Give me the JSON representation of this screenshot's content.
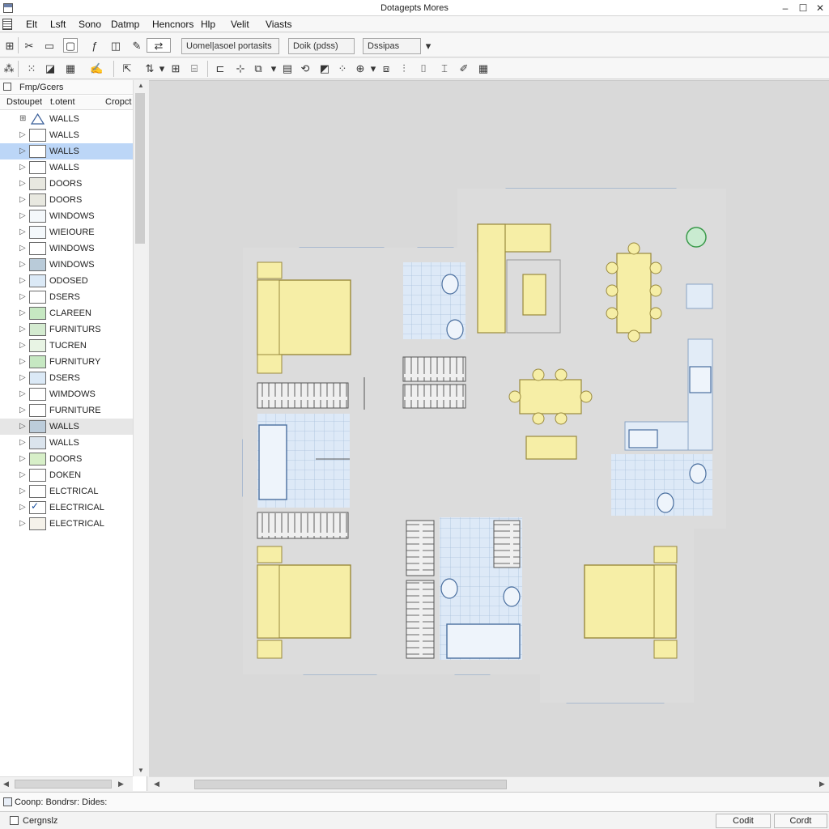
{
  "window": {
    "title": "Dotagepts Mores",
    "min": "–",
    "max": "☐",
    "close": "✕"
  },
  "menu": [
    "Elt",
    "Lsft",
    "Sono",
    "Datmp",
    "Hencnors",
    "Hlp",
    "Velit",
    "Viasts"
  ],
  "toolbar1": {
    "field1": "Uomel|asoel portasits ▾",
    "field2": "Doik (pdss)",
    "field3": "Dssipas",
    "dropdown_arrow": "▾",
    "icons": [
      "scissors-icon",
      "copy-icon",
      "line-tool-icon",
      "box-tool-icon",
      "move-icon"
    ]
  },
  "toolbar2": {
    "icons": [
      "snap-icon",
      "grid-icon",
      "grid-dots-icon",
      "layer-icon",
      "pen-icon",
      "cursor-icon",
      "mirror-icon",
      "grid-icon",
      "stairs-icon",
      "align-icon",
      "node-icon",
      "cube-icon",
      "table-icon",
      "rotate-icon",
      "chart-icon",
      "grid-dots-icon",
      "zoom-icon",
      "layers-icon",
      "chart-icon",
      "wall-icon",
      "ruler-icon",
      "grid-icon"
    ]
  },
  "layers_panel": {
    "title": "Fmp/Gcers",
    "collapse": "▲",
    "columns": [
      "Dstoupet",
      "t.otent",
      "Cropct"
    ],
    "items": [
      {
        "name": "WALLS",
        "swatch": "triangle",
        "color": "#ffffff",
        "expander": "⊞"
      },
      {
        "name": "WALLS",
        "color": "#ffffff",
        "expander": "▷"
      },
      {
        "name": "WALLS",
        "color": "#ffffff",
        "expander": "▷",
        "selected": true
      },
      {
        "name": "WALLS",
        "color": "#ffffff",
        "expander": "▷"
      },
      {
        "name": "DOORS",
        "color": "#e8e8e0",
        "expander": "▷"
      },
      {
        "name": "DOORS",
        "color": "#e8e8e0",
        "expander": "▷"
      },
      {
        "name": "WINDOWS",
        "color": "#f4f8fb",
        "expander": "▷"
      },
      {
        "name": "WIEIOURE",
        "color": "#f4f8fb",
        "expander": "▷"
      },
      {
        "name": "WINDOWS",
        "color": "#ffffff",
        "expander": "▷"
      },
      {
        "name": "WINDOWS",
        "color": "#b9cbd9",
        "expander": "▷"
      },
      {
        "name": "ODOSED",
        "color": "#dbe9f6",
        "expander": "▷"
      },
      {
        "name": "DSERS",
        "color": "#ffffff",
        "expander": "▷"
      },
      {
        "name": "CLAREEN",
        "color": "#c6e8c2",
        "expander": "▷"
      },
      {
        "name": "FURNITURS",
        "color": "#d4ebd0",
        "expander": "▷"
      },
      {
        "name": "TUCREN",
        "color": "#e8f4e4",
        "expander": "▷"
      },
      {
        "name": "FURNITURY",
        "color": "#c6e8c2",
        "expander": "▷"
      },
      {
        "name": "DSERS",
        "color": "#dbe9f6",
        "expander": "▷"
      },
      {
        "name": "WIMDOWS",
        "color": "#ffffff",
        "expander": "▷"
      },
      {
        "name": "FURNITURE",
        "color": "#ffffff",
        "expander": "▷"
      },
      {
        "name": "WALLS",
        "color": "#bcccda",
        "expander": "▷",
        "highlight": true
      },
      {
        "name": "WALLS",
        "color": "#dbe4ed",
        "expander": "▷"
      },
      {
        "name": "DOORS",
        "color": "#d7efc8",
        "expander": "▷"
      },
      {
        "name": "DOKEN",
        "color": "#ffffff",
        "expander": "▷"
      },
      {
        "name": "ELCTRICAL",
        "color": "#ffffff",
        "expander": "▷"
      },
      {
        "name": "ELECTRICAL",
        "color": "#ffffff",
        "expander": "▷",
        "checked": true,
        "check_mark": "✓"
      },
      {
        "name": "ELECTRICAL",
        "color": "#f5f2ea",
        "expander": "▷"
      }
    ]
  },
  "scroll": {
    "left": "◀",
    "right": "▶",
    "up": "▲",
    "down": "▼"
  },
  "colors": {
    "wall": "#0f3b7a",
    "window": "#d8e6f4",
    "furniture": "#f6eea6",
    "furniture_stroke": "#9a8a3e",
    "tile": "#dde9f7",
    "canvas": "#d9d9d9",
    "floor": "#dcdcdc"
  },
  "command_line": "Coonp: Bondrsr: Dides:",
  "status": {
    "text": "Cergnslz",
    "button1": "Codit",
    "button2": "Cordt"
  }
}
